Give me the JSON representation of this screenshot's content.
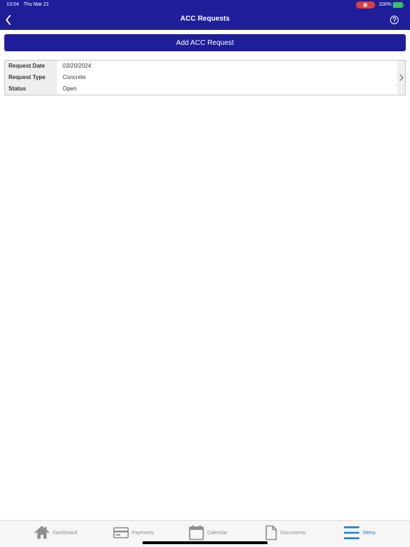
{
  "status_bar": {
    "time": "13:04",
    "date": "Thu Mar 21",
    "battery": "100%"
  },
  "nav": {
    "title": "ACC Requests"
  },
  "actions": {
    "add_label": "Add ACC Request"
  },
  "request": {
    "rows": [
      {
        "label": "Request Date",
        "value": "03/20/2024"
      },
      {
        "label": "Request Type",
        "value": "Concrete"
      },
      {
        "label": "Status",
        "value": "Open"
      }
    ]
  },
  "tabs": [
    {
      "label": "Dashboard",
      "icon": "home-icon"
    },
    {
      "label": "Payments",
      "icon": "credit-card-icon"
    },
    {
      "label": "Calendar",
      "icon": "calendar-icon"
    },
    {
      "label": "Documents",
      "icon": "document-icon"
    },
    {
      "label": "Menu",
      "icon": "menu-icon",
      "active": true
    }
  ],
  "colors": {
    "primary": "#1e1e9a",
    "active_tab": "#1a7fe0",
    "inactive_tab": "#8e8e8e",
    "recording": "#e33a3a",
    "battery": "#34c759"
  }
}
